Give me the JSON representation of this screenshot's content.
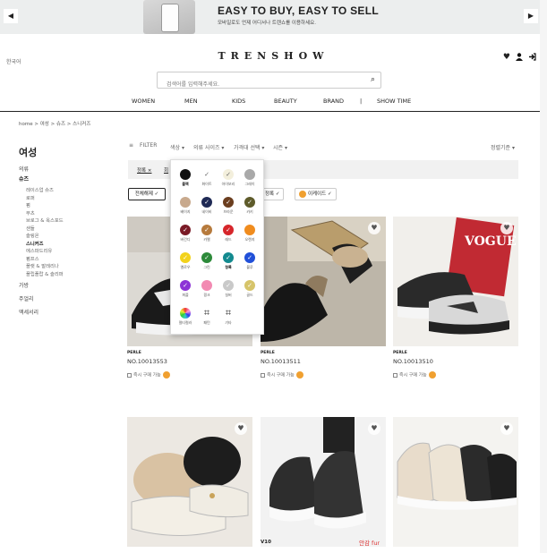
{
  "banner": {
    "headline": "EASY TO BUY, EASY TO SELL",
    "sub": "모바일로도 언제 어디서나 트렌쇼를 이용하세요.",
    "prev_icon": "◀",
    "next_icon": "▶"
  },
  "header": {
    "lang": "한국어",
    "logo": "TRENSHOW",
    "icons": {
      "wishlist": "♥",
      "user": "👤",
      "login": "➜"
    }
  },
  "search": {
    "placeholder": "검색어를 입력해주세요.",
    "icon": "⌕"
  },
  "nav": [
    "WOMEN",
    "MEN",
    "KIDS",
    "BEAUTY",
    "BRAND",
    "|",
    "SHOW TIME"
  ],
  "breadcrumb": "home  >  여성  >  슈즈  >  스니커즈",
  "sidebar": {
    "title": "여성",
    "items": [
      {
        "label": "의류",
        "type": "top"
      },
      {
        "label": "슈즈",
        "type": "active"
      },
      {
        "label": "레이스업 슈즈",
        "type": "sub"
      },
      {
        "label": "로퍼",
        "type": "sub"
      },
      {
        "label": "펌",
        "type": "sub"
      },
      {
        "label": "부츠",
        "type": "sub"
      },
      {
        "label": "브로그 & 옥스포드",
        "type": "sub"
      },
      {
        "label": "샌들",
        "type": "sub"
      },
      {
        "label": "슬링온",
        "type": "sub"
      },
      {
        "label": "스니커즈",
        "type": "sub-bold"
      },
      {
        "label": "에스파드리유",
        "type": "sub"
      },
      {
        "label": "펌프스",
        "type": "sub"
      },
      {
        "label": "플랫 & 발레리나",
        "type": "sub"
      },
      {
        "label": "플립플랍 & 슬리퍼",
        "type": "sub"
      },
      {
        "label": "가방",
        "type": "top"
      },
      {
        "label": "주얼리",
        "type": "top"
      },
      {
        "label": "액세서리",
        "type": "top"
      }
    ]
  },
  "filters": {
    "label": "FILTER",
    "icon": "≡",
    "dropdowns": [
      "색상 ▾",
      "의류 사이즈 ▾",
      "가격대 선택 ▾",
      "시즌 ▾"
    ],
    "sort": "정렬기준 ▾",
    "selected": [
      "정록 ×",
      "회"
    ],
    "reset": "전체해제 ✓",
    "chips": [
      "정록 ✓",
      "이케이드 ✓"
    ]
  },
  "color_popup": {
    "colors": [
      {
        "name": "블랙",
        "hex": "#111111",
        "check": "",
        "bold": true
      },
      {
        "name": "화이트",
        "hex": "#ffffff",
        "check": "✓"
      },
      {
        "name": "아이보리",
        "hex": "#f3efdc",
        "check": "✓"
      },
      {
        "name": "그레이",
        "hex": "#a9a9a9",
        "check": ""
      },
      {
        "name": "베이지",
        "hex": "#c8a98d",
        "check": ""
      },
      {
        "name": "네이비",
        "hex": "#1f2a55",
        "check": "✓"
      },
      {
        "name": "브라운",
        "hex": "#6b3e1f",
        "check": "✓"
      },
      {
        "name": "카키",
        "hex": "#5e5b2a",
        "check": "✓"
      },
      {
        "name": "버건디",
        "hex": "#7a1a26",
        "check": "✓"
      },
      {
        "name": "카멜",
        "hex": "#b67a3c",
        "check": "✓"
      },
      {
        "name": "레드",
        "hex": "#d6262b",
        "check": "✓"
      },
      {
        "name": "오렌지",
        "hex": "#f08c1e",
        "check": ""
      },
      {
        "name": "옐로우",
        "hex": "#f2d21b",
        "check": "✓"
      },
      {
        "name": "그린",
        "hex": "#2d8a3a",
        "check": "✓"
      },
      {
        "name": "청록",
        "hex": "#138a8f",
        "check": "✓",
        "bold": true
      },
      {
        "name": "블루",
        "hex": "#2150d8",
        "check": "✓"
      },
      {
        "name": "퍼플",
        "hex": "#8c33d6",
        "check": "✓"
      },
      {
        "name": "핑크",
        "hex": "#f28ab2",
        "check": ""
      },
      {
        "name": "실버",
        "hex": "#c9c9c9",
        "check": "✓"
      },
      {
        "name": "골드",
        "hex": "#d6c46a",
        "check": "✓"
      },
      {
        "name": "멀티컬러",
        "hex": "multi",
        "check": ""
      },
      {
        "name": "패턴",
        "hex": "pattern",
        "check": "⌗"
      },
      {
        "name": "기타",
        "hex": "pattern",
        "check": "⌗"
      }
    ]
  },
  "products": [
    {
      "brand": "PERLE",
      "no": "NO.10013553",
      "avail": "즉시 구매 가능"
    },
    {
      "brand": "PERLE",
      "no": "NO.10013511",
      "avail": "즉시 구매 가능"
    },
    {
      "brand": "PERLE",
      "no": "NO.10013510",
      "avail": "즉시 구매 가능"
    },
    {
      "brand": "",
      "no": "",
      "avail": ""
    },
    {
      "brand": "",
      "no": "",
      "avail": ""
    },
    {
      "brand": "",
      "no": "",
      "avail": ""
    }
  ],
  "bottom_labels": {
    "v10": "V10",
    "fur": "안감 fur"
  },
  "product_art": {
    "vogue": "VOGUE"
  }
}
